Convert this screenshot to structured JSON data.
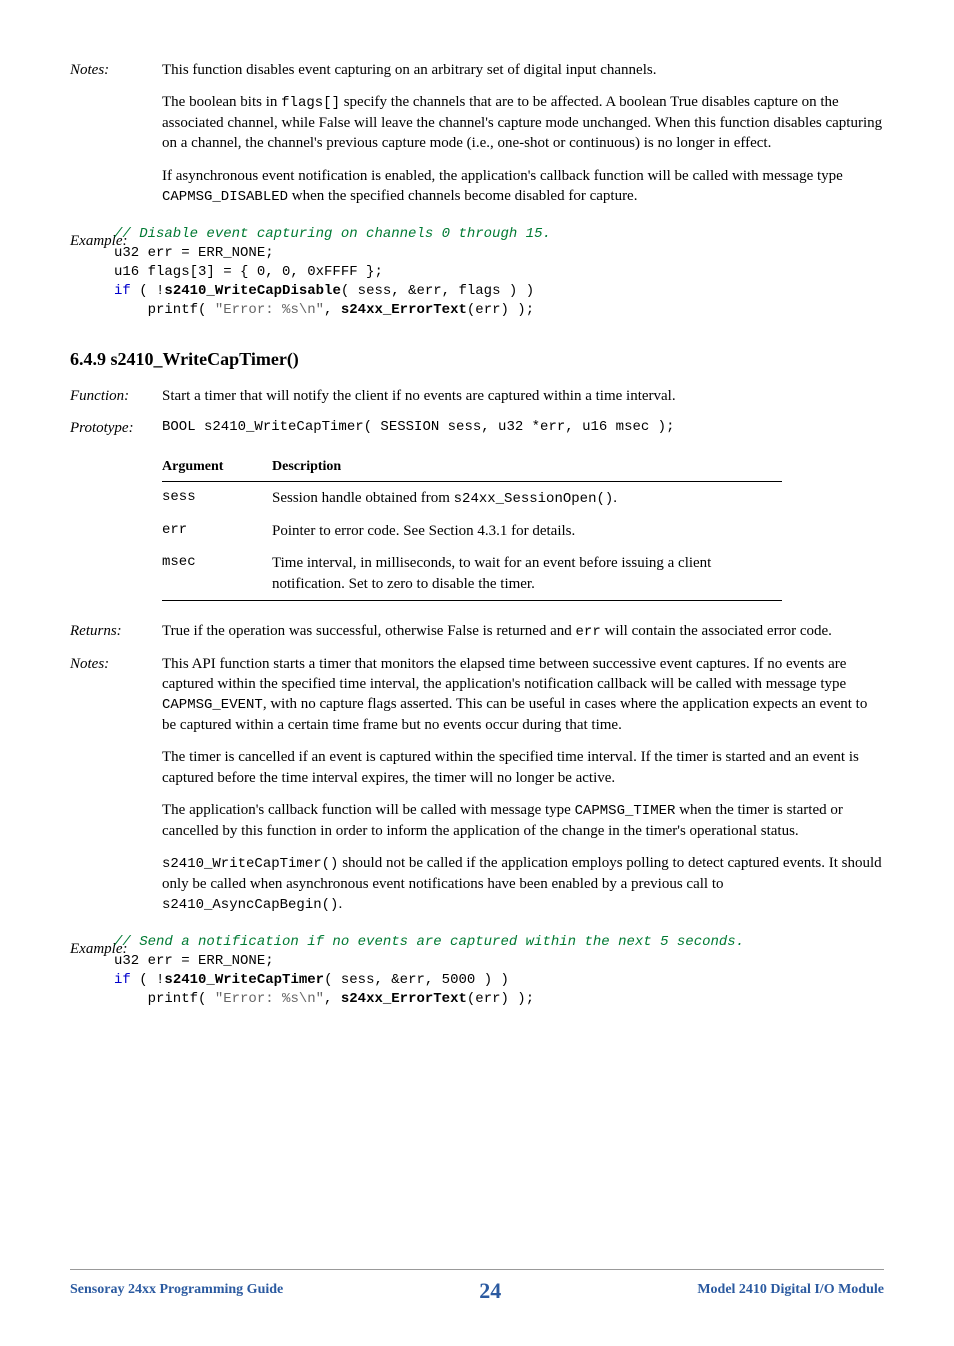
{
  "notes1": {
    "label": "Notes:",
    "p1a": "This function disables event capturing on an arbitrary set of digital input channels.",
    "p2a": "The boolean bits in ",
    "p2code": "flags[]",
    "p2b": " specify the channels that are to be affected. A boolean True disables capture on the associated channel, while False will leave the channel's capture mode unchanged. When this function disables capturing on a channel, the channel's previous capture mode (i.e., one-shot or continuous) is no longer in effect.",
    "p3a": "If asynchronous event notification is enabled, the application's callback function will be called with message type ",
    "p3code": "CAPMSG_DISABLED",
    "p3b": " when the specified channels become disabled for capture."
  },
  "example1": {
    "label": "Example:",
    "comment": "// Disable event capturing on channels 0 through 15.",
    "l1a": "u32 err = ERR_NONE;",
    "l2a": "u16 flags[3] = { 0, 0, 0xFFFF };",
    "l3_if": "if",
    "l3_rest": " ( !",
    "l3_fn": "s2410_WriteCapDisable",
    "l3_tail": "( sess, &err, flags ) )",
    "l4a": "    printf( ",
    "l4_str": "\"Error: %s\\n\"",
    "l4b": ", ",
    "l4_fn": "s24xx_ErrorText",
    "l4c": "(err) );"
  },
  "heading": "6.4.9  s2410_WriteCapTimer()",
  "function": {
    "label": "Function:",
    "text": "Start a timer that will notify the client if no events are captured within a time interval."
  },
  "prototype": {
    "label": "Prototype:",
    "text": "BOOL s2410_WriteCapTimer( SESSION sess, u32 *err, u16 msec );"
  },
  "table": {
    "h1": "Argument",
    "h2": "Description",
    "rows": [
      {
        "arg": "sess",
        "desc_a": "Session handle obtained from ",
        "desc_code": "s24xx_SessionOpen()",
        "desc_b": "."
      },
      {
        "arg": "err",
        "desc_a": "Pointer to error code. See Section 4.3.1 for details.",
        "desc_code": "",
        "desc_b": ""
      },
      {
        "arg": "msec",
        "desc_a": "Time interval, in milliseconds, to wait for an event before issuing a client notification. Set to zero to disable the timer.",
        "desc_code": "",
        "desc_b": ""
      }
    ]
  },
  "returns": {
    "label": "Returns:",
    "a": "True if the operation was successful, otherwise False is returned and ",
    "code": "err",
    "b": " will contain the associated error code."
  },
  "notes2": {
    "label": "Notes:",
    "p1a": "This API function starts a timer that monitors the elapsed time between successive event captures. If no events are captured within the specified time interval, the application's notification callback will be called with message type ",
    "p1code": "CAPMSG_EVENT",
    "p1b": ", with no capture flags asserted. This can be useful in cases where the application expects an event to be captured within a certain time frame but no events occur during that time.",
    "p2": "The timer is cancelled if an event is captured within the specified time interval. If the timer is started and an event is captured before the time interval expires, the timer will no longer be active.",
    "p3a": "The application's callback function will be called with message type ",
    "p3code": "CAPMSG_TIMER",
    "p3b": " when the timer is started or cancelled by this function in order to inform the application of the change in the timer's operational status.",
    "p4code1": "s2410_WriteCapTimer()",
    "p4a": " should not be called if the application employs polling to detect captured events. It should only be called when asynchronous event notifications have been enabled by a previous call to ",
    "p4code2": "s2410_AsyncCapBegin()",
    "p4b": "."
  },
  "example2": {
    "label": "Example:",
    "comment": "// Send a notification if no events are captured within the next 5 seconds.",
    "l1a": "u32 err = ERR_NONE;",
    "l2_if": "if",
    "l2_rest": " ( !",
    "l2_fn": "s2410_WriteCapTimer",
    "l2_tail": "( sess, &err, 5000 ) )",
    "l3a": "    printf( ",
    "l3_str": "\"Error: %s\\n\"",
    "l3b": ", ",
    "l3_fn": "s24xx_ErrorText",
    "l3c": "(err) );"
  },
  "footer": {
    "left": "Sensoray 24xx Programming Guide",
    "page": "24",
    "right": "Model 2410 Digital I/O Module"
  }
}
